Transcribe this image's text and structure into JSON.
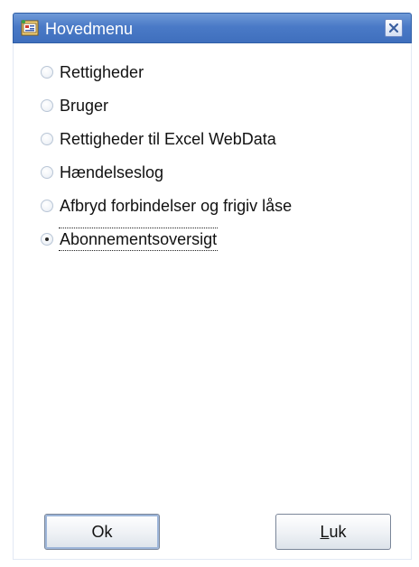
{
  "window": {
    "title": "Hovedmenu",
    "icon": "app-window-icon",
    "close_icon": "close-icon"
  },
  "options": [
    {
      "label": "Rettigheder",
      "checked": false
    },
    {
      "label": "Bruger",
      "checked": false
    },
    {
      "label": "Rettigheder til Excel WebData",
      "checked": false
    },
    {
      "label": "Hændelseslog",
      "checked": false
    },
    {
      "label": "Afbryd forbindelser og frigiv låse",
      "checked": false
    },
    {
      "label": "Abonnementsoversigt",
      "checked": true
    }
  ],
  "buttons": {
    "ok_label": "Ok",
    "close_label_mnemonic": "L",
    "close_label_rest": "uk"
  },
  "colors": {
    "titlebar": "#4a7ac7",
    "title_text": "#ffffff"
  }
}
